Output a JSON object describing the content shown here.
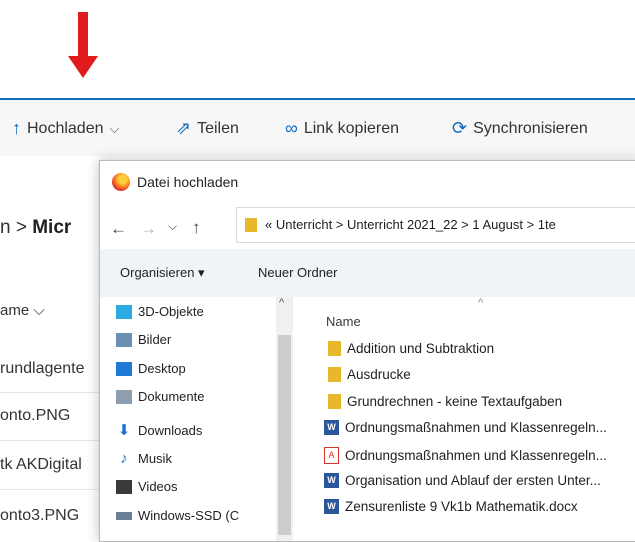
{
  "background": {
    "commands": [
      {
        "icon": "↑",
        "label": "Hochladen",
        "suffix": "⌵"
      },
      {
        "icon": "⇗",
        "label": "Teilen"
      },
      {
        "icon": "∞",
        "label": "Link kopieren"
      },
      {
        "icon": "⟳",
        "label": "Synchronisieren"
      }
    ],
    "breadcrumb_prefix": "n  >  ",
    "breadcrumb_current": "Micr",
    "column_header": "ame  ⌵",
    "rows": [
      "rundlagente",
      "onto.PNG",
      "tk AKDigital",
      "onto3.PNG"
    ]
  },
  "dialog": {
    "title": "Datei hochladen",
    "nav": {
      "back": "←",
      "forward": "→",
      "recent": "⌵",
      "up": "↑"
    },
    "address_path": "«  Unterricht  >  Unterricht 2021_22  >  1 August  >  1te",
    "toolbar": {
      "organize": "Organisieren ▾",
      "new_folder": "Neuer Ordner"
    },
    "nav_items": [
      {
        "label": "3D-Objekte",
        "icon": "cube-icon",
        "color": "#2ba9e1"
      },
      {
        "label": "Bilder",
        "icon": "pictures-icon",
        "color": "#6b8fb4"
      },
      {
        "label": "Desktop",
        "icon": "desktop-icon",
        "color": "#1e7ad6"
      },
      {
        "label": "Dokumente",
        "icon": "documents-icon",
        "color": "#8ea0b0"
      },
      {
        "label": "Downloads",
        "icon": "download-icon",
        "color": "#1e6fd1"
      },
      {
        "label": "Musik",
        "icon": "music-icon",
        "color": "#1e6fd1"
      },
      {
        "label": "Videos",
        "icon": "videos-icon",
        "color": "#3a3a3a"
      },
      {
        "label": "Windows-SSD (C",
        "icon": "drive-icon",
        "color": "#6a7f94"
      }
    ],
    "column_name": "Name",
    "files": [
      {
        "name": "Addition und Subtraktion",
        "type": "folder"
      },
      {
        "name": "Ausdrucke",
        "type": "folder"
      },
      {
        "name": "Grundrechnen - keine Textaufgaben",
        "type": "folder"
      },
      {
        "name": "Ordnungsmaßnahmen und Klassenregeln...",
        "type": "word"
      },
      {
        "name": "Ordnungsmaßnahmen und Klassenregeln...",
        "type": "pdf"
      },
      {
        "name": "Organisation und Ablauf der ersten Unter...",
        "type": "word"
      },
      {
        "name": "Zensurenliste 9 Vk1b Mathematik.docx",
        "type": "word"
      }
    ]
  }
}
